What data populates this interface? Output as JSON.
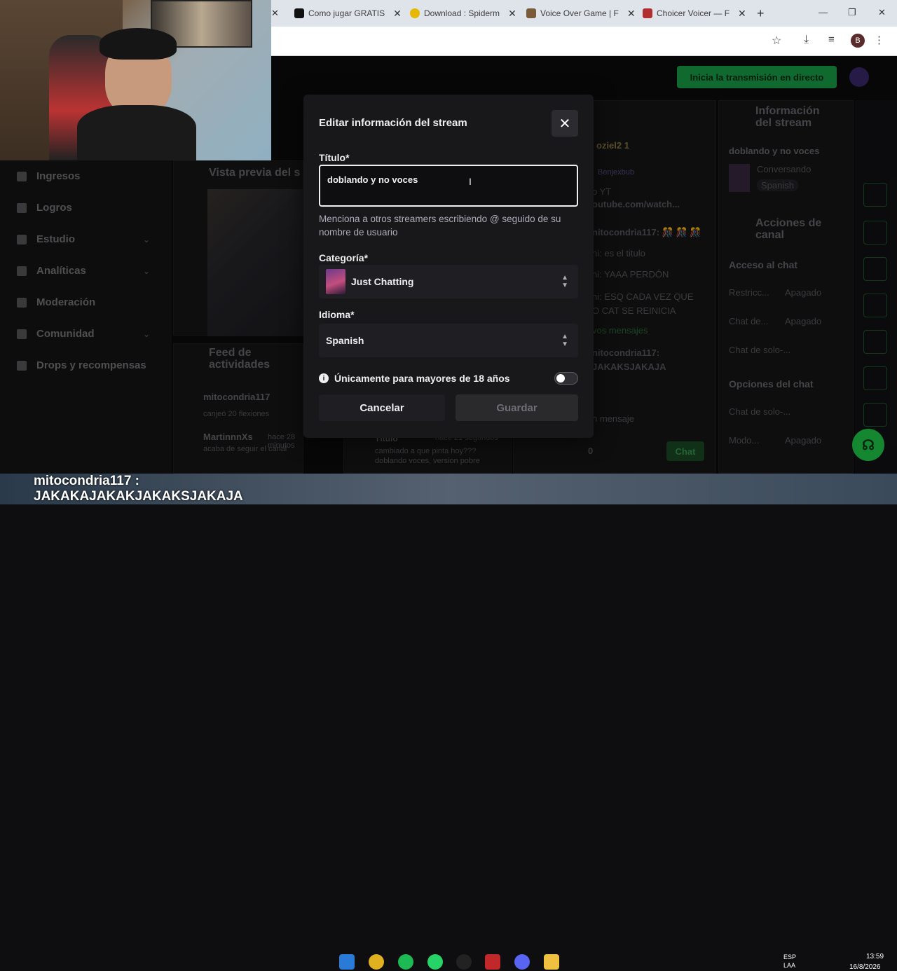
{
  "browser": {
    "tabs": [
      {
        "label": "Como jugar GRATIS",
        "color": "#111111"
      },
      {
        "label": "Download : Spiderm",
        "color": "#e6b800"
      },
      {
        "label": "Voice Over Game | F",
        "color": "#7a5c3a"
      },
      {
        "label": "Choicer Voicer — F",
        "color": "#b03030"
      }
    ],
    "new_tab": "+",
    "profile": "B"
  },
  "header": {
    "live_button": "Inicia la transmisión en directo"
  },
  "sidebar": {
    "items": [
      {
        "label": "Ingresos"
      },
      {
        "label": "Logros"
      },
      {
        "label": "Estudio"
      },
      {
        "label": "Analíticas"
      },
      {
        "label": "Moderación"
      },
      {
        "label": "Comunidad"
      },
      {
        "label": "Drops y recompensas"
      }
    ]
  },
  "background": {
    "preview_title": "Vista previa del s",
    "feed_title": "Feed de actividades",
    "feed": [
      {
        "user": "mitocondria117",
        "text": "canjeó 20 flexiones"
      },
      {
        "user": "MartinnnXs",
        "time": "hace 28 minutos",
        "text": "acaba de seguir el canal"
      }
    ],
    "title_card": {
      "label": "Título",
      "time": "hace 21 segundos",
      "text": "cambiado a que pinta hoy??? doblando voces, version pobre"
    },
    "chat": {
      "lines": [
        "oziel2 1",
        "Benjexbub",
        "o YT",
        "outube.com/watch...",
        "nitocondria117: 🎊 🎊 🎊",
        "ni: es el titulo",
        "ni: YAAA PERDÓN",
        "ni: ESQ CADA VEZ QUE O CAT SE REINICIA",
        "vos mensajes",
        "nitocondria117: JAKAKSJAKAJA"
      ],
      "input_placeholder": "n mensaje",
      "viewer_count": "0",
      "chat_button": "Chat"
    },
    "info_panel": {
      "title": "Información del stream",
      "stream_title": "doblando y no voces",
      "category": "Conversando",
      "language": "Spanish"
    },
    "actions_panel": {
      "title": "Acciones de canal",
      "access_title": "Acceso al chat",
      "rows": [
        {
          "label": "Restricc...",
          "value": "Apagado"
        },
        {
          "label": "Chat de...",
          "value": "Apagado"
        },
        {
          "label": "Chat de solo-...",
          "value": ""
        }
      ],
      "options_title": "Opciones del chat",
      "rows2": [
        {
          "label": "Chat de solo-...",
          "value": ""
        },
        {
          "label": "Modo...",
          "value": "Apagado"
        }
      ]
    }
  },
  "modal": {
    "title": "Editar información del stream",
    "title_label": "Título*",
    "title_value": "doblando y no voces",
    "title_help": "Menciona a otros streamers escribiendo @ seguido de su nombre de usuario",
    "category_label": "Categoría*",
    "category_value": "Just Chatting",
    "language_label": "Idioma*",
    "language_value": "Spanish",
    "mature_label": "Únicamente para mayores de 18 años",
    "mature_enabled": false,
    "cancel_label": "Cancelar",
    "save_label": "Guardar"
  },
  "overlay": {
    "chat_ticker": "mitocondria117 : JAKAKAJAKAKJAKAKSJAKAJA"
  },
  "taskbar": {
    "lang": "ESP\nLAA",
    "time": "13:59",
    "date": "16/8/2026"
  }
}
